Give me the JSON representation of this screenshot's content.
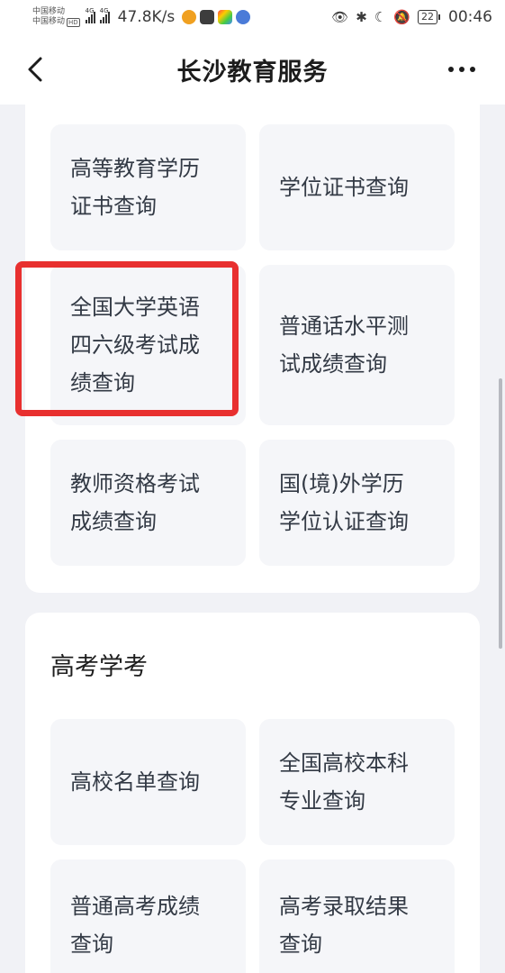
{
  "status_bar": {
    "carrier_1": "中国移动",
    "carrier_2": "中国移动",
    "hd": "HD",
    "net_1": "4G",
    "net_2": "4G",
    "speed": "47.8K/s",
    "battery": "22",
    "time": "00:46"
  },
  "nav": {
    "title": "长沙教育服务"
  },
  "top_section": {
    "tiles": [
      {
        "lines": [
          "高等教育学历",
          "证书查询"
        ]
      },
      {
        "lines": [
          "学位证书查询"
        ]
      },
      {
        "lines": [
          "全国大学英语",
          "四六级考试成",
          "绩查询"
        ]
      },
      {
        "lines": [
          "普通话水平测",
          "试成绩查询"
        ]
      },
      {
        "lines": [
          "教师资格考试",
          "成绩查询"
        ]
      },
      {
        "lines": [
          "国(境)外学历",
          "学位认证查询"
        ]
      }
    ]
  },
  "gaokao_section": {
    "title": "高考学考",
    "tiles": [
      {
        "lines": [
          "高校名单查询"
        ]
      },
      {
        "lines": [
          "全国高校本科",
          "专业查询"
        ]
      },
      {
        "lines": [
          "普通高考成绩",
          "查询"
        ]
      },
      {
        "lines": [
          "高考录取结果",
          "查询"
        ]
      }
    ]
  },
  "colors": {
    "highlight": "#e8302f",
    "tile_bg": "#f5f6f9",
    "page_bg": "#f1f2f6"
  },
  "icons": [
    "back-arrow-icon",
    "more-dots-icon",
    "eye-icon",
    "bluetooth-icon",
    "moon-icon",
    "mute-bell-icon",
    "battery-icon",
    "signal-icon"
  ]
}
